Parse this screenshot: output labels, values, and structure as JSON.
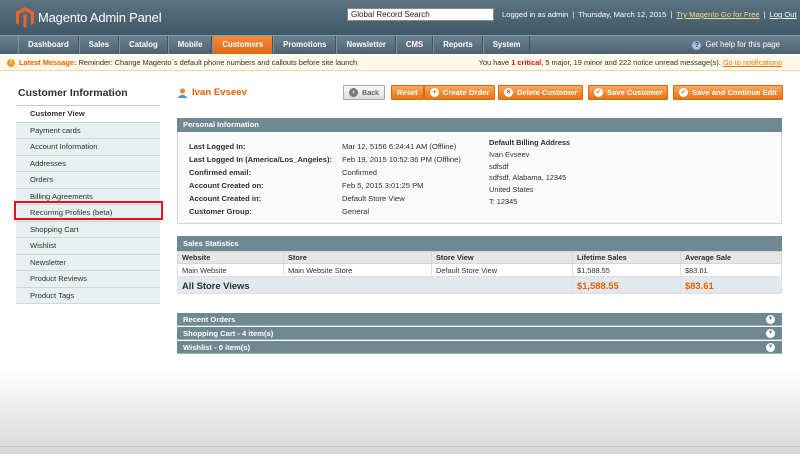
{
  "header": {
    "logo_text": "Magento Admin Panel",
    "search_value": "Global Record Search",
    "logged_in": "Logged in as admin",
    "date": "Thursday, March 12, 2015",
    "try_link": "Try Magento Go for Free",
    "logout": "Log Out",
    "sep": "|"
  },
  "nav": {
    "items": [
      "Dashboard",
      "Sales",
      "Catalog",
      "Mobile",
      "Customers",
      "Promotions",
      "Newsletter",
      "CMS",
      "Reports",
      "System"
    ],
    "active": "Customers",
    "help": "Get help for this page"
  },
  "message": {
    "label": "Latest Message:",
    "text": "Reminder: Change Magento`s default phone numbers and callouts before site launch",
    "right_prefix": "You have",
    "critical": "1 critical",
    "right_mid": ", 5 major, 19 minor and 222 notice unread message(s).",
    "link": "Go to notifications"
  },
  "sidebar": {
    "title": "Customer Information",
    "items": [
      "Customer View",
      "Payment cards",
      "Account Information",
      "Addresses",
      "Orders",
      "Billing Agreements",
      "Recurring Profiles (beta)",
      "Shopping Cart",
      "Wishlist",
      "Newsletter",
      "Product Reviews",
      "Product Tags"
    ],
    "highlighted": "Recurring Profiles (beta)"
  },
  "page": {
    "title": "Ivan Evseev",
    "buttons": {
      "back": "Back",
      "reset": "Reset",
      "create_order": "Create Order",
      "delete": "Delete Customer",
      "save": "Save Customer",
      "save_continue": "Save and Continue Edit"
    }
  },
  "personal": {
    "title": "Personal Information",
    "rows": [
      {
        "label": "Last Logged In:",
        "value": "Mar 12, 5156 6:24:41 AM (Offline)"
      },
      {
        "label": "Last Logged In (America/Los_Angeles):",
        "value": "Feb 19, 2015 10:52:36 PM (Offline)"
      },
      {
        "label": "Confirmed email:",
        "value": "Confirmed"
      },
      {
        "label": "Account Created on:",
        "value": "Feb 5, 2015 3:01:25 PM"
      },
      {
        "label": "Account Created in:",
        "value": "Default Store View"
      },
      {
        "label": "Customer Group:",
        "value": "General"
      }
    ],
    "billing_title": "Default Billing Address",
    "billing_lines": [
      "Ivan Evseev",
      "sdfsdf",
      "sdfsdf, Alabama, 12345",
      "United States",
      "T: 12345"
    ]
  },
  "sales": {
    "title": "Sales Statistics",
    "columns": [
      "Website",
      "Store",
      "Store View",
      "Lifetime Sales",
      "Average Sale"
    ],
    "row": [
      "Main Website",
      "Main Website Store",
      "Default Store View",
      "$1,588.55",
      "$83.61"
    ],
    "total_label": "All Store Views",
    "total_lifetime": "$1,588.55",
    "total_average": "$83.61"
  },
  "accordions": [
    "Recent Orders",
    "Shopping Cart - 4 item(s)",
    "Wishlist - 0 item(s)"
  ],
  "colors": {
    "accent": "#eb5e00",
    "header": "#4b6270",
    "box_header": "#6f8992",
    "highlight": "#e8101c"
  }
}
